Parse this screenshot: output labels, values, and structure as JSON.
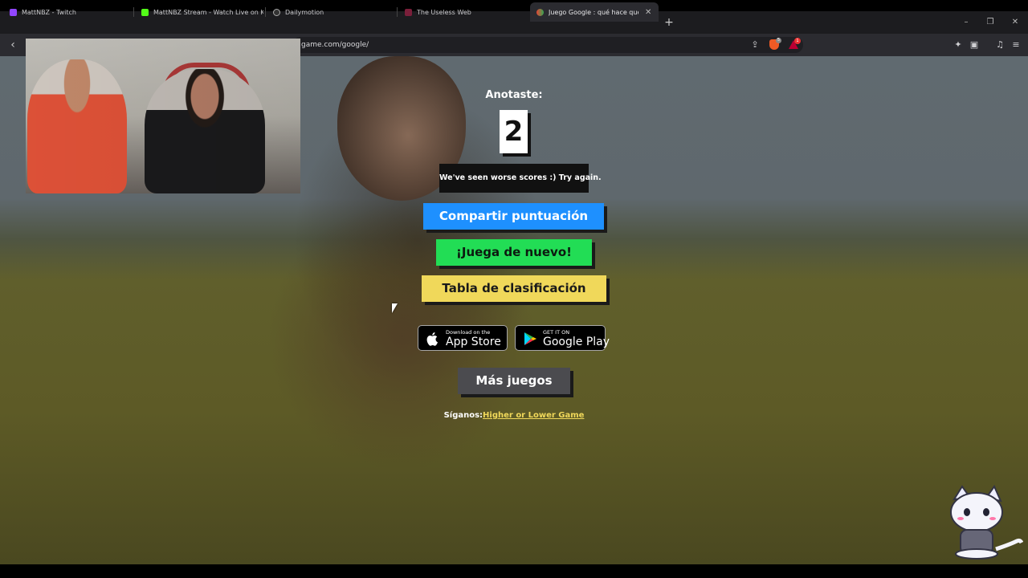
{
  "browser": {
    "tabs": [
      {
        "label": "MattNBZ - Twitch",
        "icon": "twitch-icon",
        "color": "#9146ff"
      },
      {
        "label": "MattNBZ Stream - Watch Live on Kick",
        "icon": "kick-icon",
        "color": "#53fc18"
      },
      {
        "label": "Dailymotion",
        "icon": "dailymotion-icon",
        "color": "#cccccc"
      },
      {
        "label": "The Useless Web",
        "icon": "useless-web-icon",
        "color": "#ff2d6f"
      },
      {
        "label": "Juego Google : qué hace que Google",
        "icon": "google-game-icon",
        "color": "#ea4335",
        "active": true
      }
    ],
    "new_tab_symbol": "+",
    "url": "game.com/google/",
    "window_controls": {
      "minimize": "–",
      "restore": "❐",
      "close": "✕"
    },
    "brave_badge": "5",
    "rewards_badge": "1"
  },
  "game": {
    "score_label": "Anotaste:",
    "score": "2",
    "message": "We've seen worse scores :) Try again.",
    "share_button": "Compartir puntuación",
    "play_again_button": "¡Juega de nuevo!",
    "leaderboard_button": "Tabla de clasificación",
    "app_store": {
      "small": "Download on the",
      "big": "App Store"
    },
    "google_play": {
      "small": "GET IT ON",
      "big": "Google Play"
    },
    "more_games_button": "Más juegos",
    "follow_label": "Síganos:",
    "follow_link": "Higher or Lower Game"
  },
  "colors": {
    "share": "#1e90ff",
    "play_again": "#22dd55",
    "leaderboard": "#f0d85a",
    "more_games": "#4b4b4f"
  }
}
